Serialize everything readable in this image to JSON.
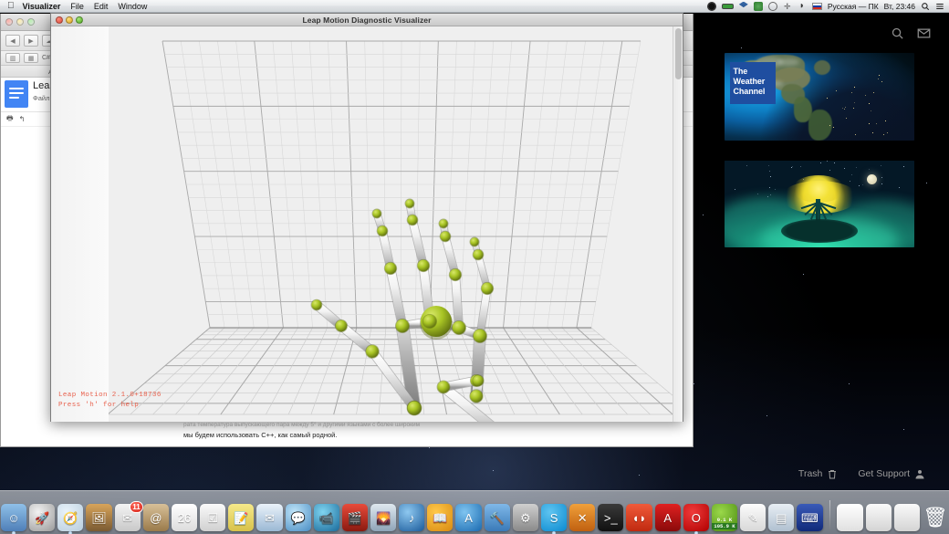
{
  "menubar": {
    "apple": "",
    "items": [
      {
        "label": "Visualizer",
        "bold": true
      },
      {
        "label": "File",
        "bold": false
      },
      {
        "label": "Edit",
        "bold": false
      },
      {
        "label": "Window",
        "bold": false
      }
    ],
    "status_icons": [
      "contrast-icon",
      "battery-icon",
      "dropbox-icon",
      "sync-icon",
      "time-machine-icon",
      "airplay-icon",
      "wifi-icon"
    ],
    "input_source": "Русская — ПК",
    "clock": "Вт, 23:46",
    "search_icon": "spotlight-search-icon",
    "notifications_icon": "notification-center-icon"
  },
  "visualizer_window": {
    "title": "Leap Motion Diagnostic Visualizer",
    "traffic_lights": [
      "close-button",
      "minimize-button",
      "zoom-button"
    ],
    "overlay_line1": "Leap Motion 2.1.0+18736",
    "overlay_line2": "Press 'h' for help",
    "overlay_color": "#e8604c",
    "scene": {
      "description": "3D skeletal hand tracking render",
      "joint_color": "#a8c424",
      "bone_color": "#e8e8e8",
      "grid_background": "#efefef",
      "grid_line_color": "#808080"
    }
  },
  "background_window": {
    "traffic_lights": [
      "close-button",
      "minimize-button",
      "zoom-button"
    ],
    "toolbar_icons": [
      "back-icon",
      "forward-icon",
      "icloud-icon",
      "book-icon",
      "grid-icon"
    ],
    "address_hint": "C# fo",
    "bookmarks_label": "Airspace Ap",
    "doc_title": "Leap",
    "doc_menu": "Файл",
    "doc_tools": [
      "print-icon",
      "undo-icon"
    ],
    "body_text": "мы будем использовать C++, как самый родной.",
    "body_text_faint": "рата температура выпускающего пара между 5° и другими языками с более широким"
  },
  "widgets": {
    "header_icons": [
      {
        "name": "search-icon"
      },
      {
        "name": "mail-icon"
      }
    ],
    "cards": [
      {
        "name": "weather-channel-widget",
        "logo_lines": [
          "The",
          "Weather",
          "Channel"
        ],
        "logo_color": "#1f4ea0"
      },
      {
        "name": "glowing-tree-widget",
        "logo_lines": [],
        "logo_color": "#f2e032"
      }
    ]
  },
  "bottom_bar": {
    "items": [
      {
        "label": "Trash",
        "icon": "trash-icon"
      },
      {
        "label": "Get Support",
        "icon": "person-icon"
      }
    ]
  },
  "dock": {
    "items": [
      {
        "name": "finder",
        "glyph": "☺",
        "bg": "linear-gradient(180deg,#8fc0e8,#4f7fb8)",
        "badge": "",
        "running": true
      },
      {
        "name": "launchpad",
        "glyph": "🚀",
        "bg": "radial-gradient(circle at 35% 30%,#f2f2f2,#9a9a9a)",
        "badge": "",
        "running": false
      },
      {
        "name": "safari",
        "glyph": "🧭",
        "bg": "radial-gradient(circle at 35% 30%,#e8f2fa,#b8cddd)",
        "badge": "",
        "running": true
      },
      {
        "name": "iphoto",
        "glyph": "🖼",
        "bg": "linear-gradient(180deg,#d8a45a,#7a5a32)",
        "badge": "",
        "running": false
      },
      {
        "name": "mail",
        "glyph": "✉",
        "bg": "linear-gradient(180deg,#f4f4f4,#c8c8c8)",
        "badge": "11",
        "running": false
      },
      {
        "name": "contacts",
        "glyph": "@",
        "bg": "linear-gradient(180deg,#d8c098,#9a7a4a)",
        "badge": "",
        "running": false
      },
      {
        "name": "calendar",
        "glyph": "26",
        "bg": "linear-gradient(180deg,#ffffff,#dcdcdc)",
        "badge": "",
        "running": false
      },
      {
        "name": "reminders",
        "glyph": "☑",
        "bg": "linear-gradient(180deg,#fafafa,#d0d0d0)",
        "badge": "",
        "running": false
      },
      {
        "name": "notes",
        "glyph": "📝",
        "bg": "linear-gradient(180deg,#f6e98a,#d8c24a)",
        "badge": "",
        "running": false
      },
      {
        "name": "messages-alt",
        "glyph": "✉",
        "bg": "linear-gradient(180deg,#eaf2fa,#9ab8d4)",
        "badge": "",
        "running": false
      },
      {
        "name": "messages",
        "glyph": "💬",
        "bg": "radial-gradient(circle at 35% 30%,#bfe4f8,#4a8ec4)",
        "badge": "",
        "running": false
      },
      {
        "name": "facetime",
        "glyph": "📹",
        "bg": "radial-gradient(circle at 35% 30%,#7fd4f0,#1a6a9a)",
        "badge": "",
        "running": false
      },
      {
        "name": "imovie",
        "glyph": "🎬",
        "bg": "linear-gradient(180deg,#e84a3a,#8a1a10)",
        "badge": "",
        "running": false
      },
      {
        "name": "photos",
        "glyph": "🌄",
        "bg": "linear-gradient(180deg,#dfe8ef,#8fa4b8)",
        "badge": "",
        "running": false
      },
      {
        "name": "itunes",
        "glyph": "♪",
        "bg": "radial-gradient(circle at 35% 30%,#8ec8f0,#1a5a9a)",
        "badge": "",
        "running": false
      },
      {
        "name": "ibooks",
        "glyph": "📖",
        "bg": "radial-gradient(circle at 35% 30%,#ffc84a,#d88a10)",
        "badge": "",
        "running": false
      },
      {
        "name": "app-store",
        "glyph": "A",
        "bg": "radial-gradient(circle at 35% 30%,#7fc4f0,#1a6ab0)",
        "badge": "",
        "running": false
      },
      {
        "name": "xcode",
        "glyph": "🔨",
        "bg": "linear-gradient(180deg,#7fb8e8,#3a7ab8)",
        "badge": "",
        "running": false
      },
      {
        "name": "system-preferences",
        "glyph": "⚙",
        "bg": "linear-gradient(180deg,#cfcfcf,#8a8a8a)",
        "badge": "",
        "running": false
      },
      {
        "name": "skype",
        "glyph": "S",
        "bg": "radial-gradient(circle at 35% 30%,#5fc4f0,#0a8ad0)",
        "badge": "",
        "running": true
      },
      {
        "name": "xquartz",
        "glyph": "✕",
        "bg": "linear-gradient(180deg,#f0a03a,#c06010)",
        "badge": "",
        "running": false
      },
      {
        "name": "terminal",
        "glyph": ">_",
        "bg": "linear-gradient(180deg,#3a3a3a,#101010)",
        "badge": "",
        "running": false
      },
      {
        "name": "opera-mail",
        "glyph": "◖◗",
        "bg": "linear-gradient(180deg,#f05a3a,#c02a10)",
        "badge": "",
        "running": false
      },
      {
        "name": "adobe-reader",
        "glyph": "A",
        "bg": "linear-gradient(180deg,#e02020,#8a0a0a)",
        "badge": "",
        "running": false
      },
      {
        "name": "opera",
        "glyph": "O",
        "bg": "radial-gradient(circle at 35% 30%,#f03a3a,#b00000)",
        "badge": "",
        "running": true
      },
      {
        "name": "network-monitor",
        "glyph": "",
        "bg": "radial-gradient(circle at 35% 30%,#9ad84a,#4a8a10)",
        "badge": "",
        "running": false,
        "net_up": "0.1 K",
        "net_down": "105.9 K"
      },
      {
        "name": "textedit",
        "glyph": "✎",
        "bg": "linear-gradient(180deg,#fcfcfc,#d8d8d8)",
        "badge": "",
        "running": false
      },
      {
        "name": "folder-apps",
        "glyph": "▤",
        "bg": "linear-gradient(180deg,#e8eef4,#b0c0d0)",
        "badge": "",
        "running": false
      },
      {
        "name": "keyboard-viewer",
        "glyph": "⌨",
        "bg": "linear-gradient(180deg,#3a5ab8,#102a7a)",
        "badge": "",
        "running": false
      },
      {
        "name": "document-blank",
        "glyph": "",
        "bg": "linear-gradient(180deg,#ffffff,#e0e0e0)",
        "badge": "",
        "running": false
      },
      {
        "name": "document-window",
        "glyph": "",
        "bg": "linear-gradient(180deg,#fafafa,#d4d4d4)",
        "badge": "",
        "running": false
      },
      {
        "name": "document-pdf",
        "glyph": "",
        "bg": "linear-gradient(180deg,#fafafa,#d4d4d4)",
        "badge": "",
        "running": false
      },
      {
        "name": "trash",
        "glyph": "🗑",
        "bg": "linear-gradient(180deg,#e4e4e4,#a8a8a8)",
        "badge": "",
        "running": false
      }
    ]
  }
}
